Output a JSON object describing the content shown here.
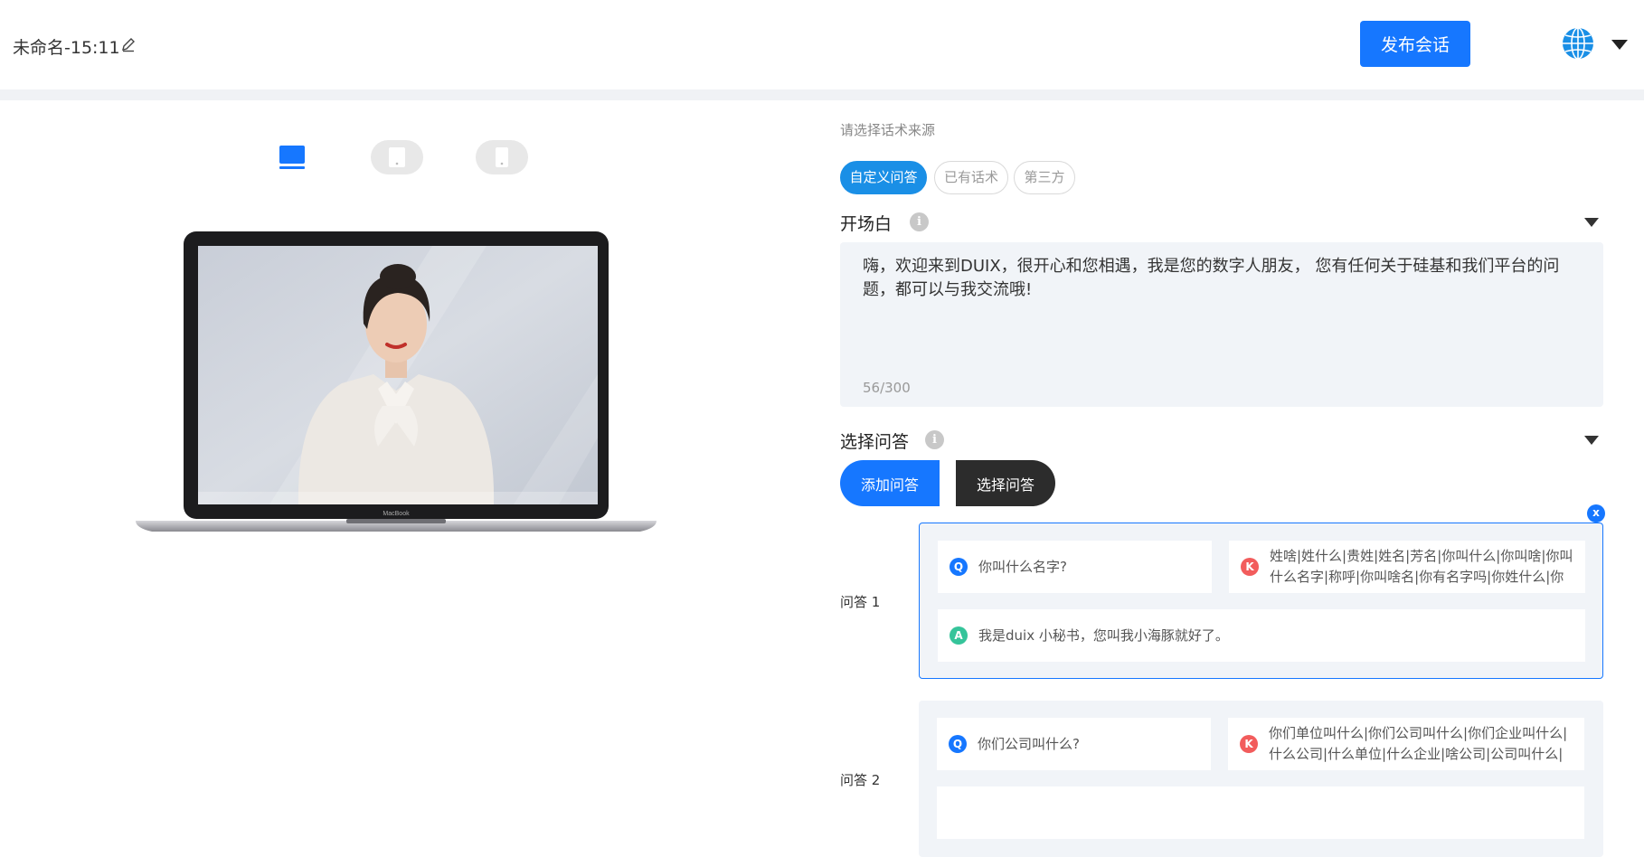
{
  "header": {
    "doc_title": "未命名-15:11",
    "publish_label": "发布会话",
    "edit_icon": "pencil-icon",
    "language_icon": "globe-icon",
    "menu_icon": "caret-down-icon"
  },
  "device_switch": {
    "options": [
      "desktop",
      "tablet",
      "phone"
    ],
    "selected": "desktop"
  },
  "preview": {
    "laptop_brand": "MacBook"
  },
  "source": {
    "label": "请选择话术来源",
    "tabs": [
      "自定义问答",
      "已有话术",
      "第三方"
    ],
    "active": "自定义问答"
  },
  "opening": {
    "title": "开场白",
    "info": "i",
    "text": "嗨，欢迎来到DUIX，很开心和您相遇，我是您的数字人朋友， 您有任何关于硅基和我们平台的问题，都可以与我交流哦!",
    "count": "56/300"
  },
  "qa": {
    "title": "选择问答",
    "info": "i",
    "add_label": "添加问答",
    "select_label": "选择问答",
    "remove_label": "x",
    "items": [
      {
        "label": "问答 1",
        "q_badge": "Q",
        "question": "你叫什么名字?",
        "k_badge": "K",
        "keywords": "姓啥|姓什么|贵姓|姓名|芳名|你叫什么|你叫啥|你叫什么名字|称呼|你叫啥名|你有名字吗|你姓什么|你姓",
        "a_badge": "A",
        "answer": "我是duix 小秘书，您叫我小海豚就好了。"
      },
      {
        "label": "问答 2",
        "q_badge": "Q",
        "question": "你们公司叫什么?",
        "k_badge": "K",
        "keywords": "你们单位叫什么|你们公司叫什么|你们企业叫什么|什么公司|什么单位|什么企业|啥公司|公司叫什么|哪"
      }
    ]
  },
  "colors": {
    "primary": "#1677ff",
    "tab_active": "#1a8fe6",
    "dark_button": "#2c2c2c",
    "panel_bg": "#f1f4f8",
    "badge_q": "#1677ff",
    "badge_k": "#f25c5c",
    "badge_a": "#35c49a"
  }
}
